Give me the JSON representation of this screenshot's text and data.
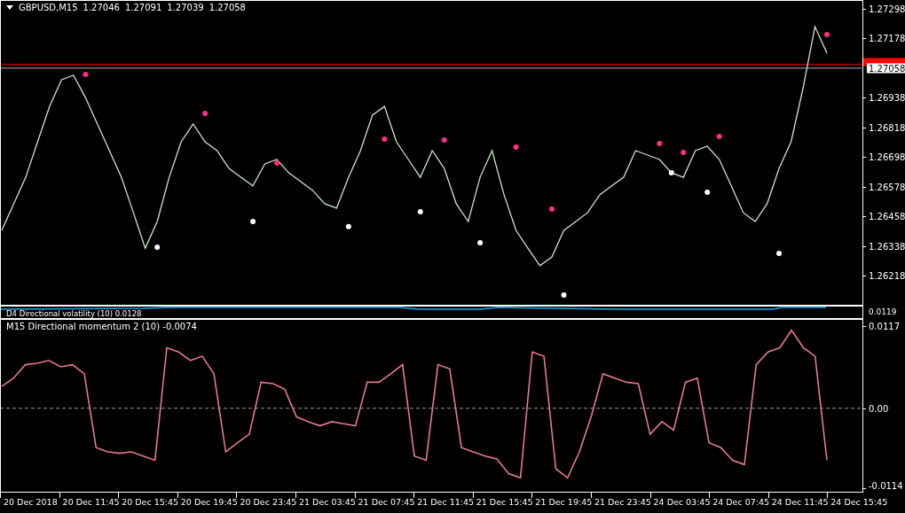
{
  "price_panel": {
    "symbol": "GBPUSD,M15",
    "quotes": [
      "1.27046",
      "1.27091",
      "1.27039",
      "1.27058"
    ],
    "chart_data": {
      "type": "line",
      "ylim": [
        1.26096,
        1.27334
      ],
      "yticks": [
        {
          "value": 1.27298,
          "label": "1.27298"
        },
        {
          "value": 1.27178,
          "label": "1.27178"
        },
        {
          "value": 1.26938,
          "label": "1.26938"
        },
        {
          "value": 1.26818,
          "label": "1.26818"
        },
        {
          "value": 1.26698,
          "label": "1.26698"
        },
        {
          "value": 1.26578,
          "label": "1.26578"
        },
        {
          "value": 1.26458,
          "label": "1.26458"
        },
        {
          "value": 1.26338,
          "label": "1.26338"
        },
        {
          "value": 1.26218,
          "label": "1.26218"
        }
      ],
      "ref_lines": [
        {
          "axis": "y",
          "value": 1.27073,
          "color": "#ff0000"
        },
        {
          "axis": "y",
          "value": 1.27058,
          "color": "#b0b0b0",
          "label": "1.27058"
        }
      ],
      "series": [
        {
          "color": "#c8e8c8",
          "values": [
            1.26401,
            1.26509,
            1.26616,
            1.2676,
            1.26903,
            1.27011,
            1.27029,
            1.26939,
            1.26832,
            1.26724,
            1.26616,
            1.26473,
            1.26329,
            1.26437,
            1.26616,
            1.2676,
            1.26832,
            1.2676,
            1.26724,
            1.26652,
            1.26616,
            1.26581,
            1.2667,
            1.26688,
            1.26634,
            1.26598,
            1.26563,
            1.26509,
            1.26491,
            1.26616,
            1.26724,
            1.26868,
            1.26903,
            1.2676,
            1.26688,
            1.26616,
            1.26724,
            1.26652,
            1.26509,
            1.26437,
            1.26616,
            1.26724,
            1.26545,
            1.26401,
            1.26329,
            1.26258,
            1.26293,
            1.26401,
            1.26437,
            1.26473,
            1.26545,
            1.26581,
            1.26616,
            1.26724,
            1.26706,
            1.26688,
            1.26634,
            1.26616,
            1.26724,
            1.26742,
            1.26688,
            1.26581,
            1.26473,
            1.26437,
            1.26509,
            1.26652,
            1.2676,
            1.26975,
            1.27226,
            1.27119
          ]
        },
        {
          "type": "scatter",
          "color": "#ff2b8a",
          "values": [
            null,
            null,
            null,
            null,
            null,
            null,
            null,
            1.27033,
            null,
            null,
            null,
            null,
            null,
            null,
            null,
            null,
            null,
            1.26875,
            null,
            null,
            null,
            null,
            null,
            1.26674,
            null,
            null,
            null,
            null,
            null,
            null,
            null,
            null,
            1.26771,
            null,
            null,
            null,
            null,
            1.26767,
            null,
            null,
            null,
            null,
            null,
            1.26738,
            null,
            null,
            1.26487,
            null,
            null,
            null,
            null,
            null,
            null,
            null,
            null,
            1.26753,
            null,
            1.26717,
            null,
            null,
            1.26781,
            null,
            null,
            null,
            null,
            null,
            null,
            null,
            null,
            1.27194
          ]
        },
        {
          "type": "scatter",
          "color": "#ffffff",
          "values": [
            null,
            null,
            null,
            null,
            null,
            null,
            null,
            null,
            null,
            null,
            null,
            null,
            null,
            1.26333,
            null,
            null,
            null,
            null,
            null,
            null,
            null,
            1.26437,
            null,
            null,
            null,
            null,
            null,
            null,
            null,
            1.26416,
            null,
            null,
            null,
            null,
            null,
            1.26476,
            null,
            null,
            null,
            null,
            1.26351,
            null,
            null,
            null,
            null,
            null,
            null,
            1.26139,
            null,
            null,
            null,
            null,
            null,
            null,
            null,
            null,
            1.26634,
            null,
            null,
            1.26555,
            null,
            null,
            null,
            null,
            null,
            1.26308,
            null,
            null,
            null,
            null
          ]
        }
      ]
    }
  },
  "volatility_panel": {
    "title": "D4 Directional volatility (10) 0.0128",
    "axis_label": "0.0119"
  },
  "momentum_panel": {
    "title": "M15 Directional momentum 2 (10) -0.0074",
    "chart_data": {
      "type": "line",
      "ylim": [
        -0.012,
        0.0127
      ],
      "yticks": [
        {
          "value": 0.0117,
          "label": "0.0117"
        },
        {
          "value": 0,
          "label": "0.00"
        },
        {
          "value": -0.0114,
          "label": "-0.0114"
        }
      ],
      "series": [
        {
          "color": "#e87890",
          "values": [
            0.0031,
            0.0043,
            0.0062,
            0.0064,
            0.0068,
            0.0059,
            0.0062,
            0.0049,
            -0.0056,
            -0.0062,
            -0.0064,
            -0.0062,
            -0.0068,
            -0.0074,
            0.0086,
            0.008,
            0.0068,
            0.0074,
            0.0049,
            -0.0062,
            -0.0049,
            -0.0037,
            0.0037,
            0.0035,
            0.0027,
            -0.0012,
            -0.0019,
            -0.0025,
            -0.0019,
            -0.0022,
            -0.0025,
            0.0037,
            0.0037,
            0.0049,
            0.0062,
            -0.0068,
            -0.0074,
            0.0062,
            0.0056,
            -0.0056,
            -0.0062,
            -0.0068,
            -0.0072,
            -0.0093,
            -0.0099,
            0.008,
            0.0074,
            -0.0086,
            -0.0099,
            -0.0062,
            -0.0012,
            0.0049,
            0.0043,
            0.0037,
            0.0035,
            -0.0037,
            -0.0019,
            -0.0031,
            0.0037,
            0.0043,
            -0.0049,
            -0.0056,
            -0.0074,
            -0.008,
            0.0062,
            0.008,
            0.0086,
            0.0111,
            0.0086,
            0.0074,
            -0.0074
          ]
        }
      ]
    }
  },
  "time_axis": [
    "20 Dec 2018",
    "20 Dec 11:45",
    "20 Dec 15:45",
    "20 Dec 19:45",
    "20 Dec 23:45",
    "21 Dec 03:45",
    "21 Dec 07:45",
    "21 Dec 11:45",
    "21 Dec 15:45",
    "21 Dec 19:45",
    "21 Dec 23:45",
    "24 Dec 03:45",
    "24 Dec 07:45",
    "24 Dec 11:45",
    "24 Dec 15:45"
  ]
}
